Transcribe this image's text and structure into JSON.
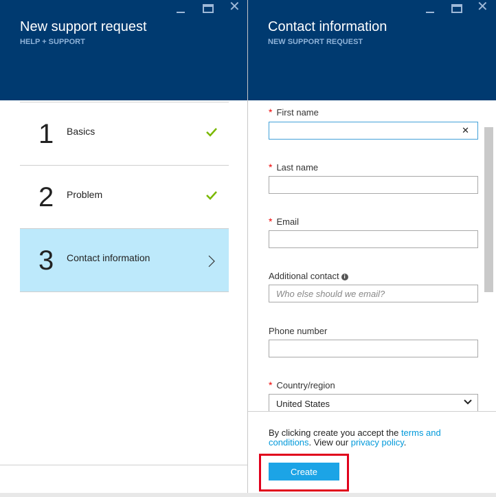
{
  "left_blade": {
    "title": "New support request",
    "subtitle": "HELP + SUPPORT",
    "steps": [
      {
        "number": "1",
        "label": "Basics",
        "status": "complete"
      },
      {
        "number": "2",
        "label": "Problem",
        "status": "complete"
      },
      {
        "number": "3",
        "label": "Contact information",
        "status": "active"
      }
    ]
  },
  "right_blade": {
    "title": "Contact information",
    "subtitle": "NEW SUPPORT REQUEST",
    "fields": {
      "first_name": {
        "label": "First name",
        "value": "",
        "required": true
      },
      "last_name": {
        "label": "Last name",
        "value": "",
        "required": true
      },
      "email": {
        "label": "Email",
        "value": "",
        "required": true
      },
      "additional_contact": {
        "label": "Additional contact",
        "placeholder": "Who else should we email?",
        "value": ""
      },
      "phone": {
        "label": "Phone number",
        "value": ""
      },
      "country": {
        "label": "Country/region",
        "value": "United States",
        "required": true
      }
    },
    "terms": {
      "prefix": "By clicking create you accept the ",
      "terms_link": "terms and conditions",
      "middle": ". View our ",
      "privacy_link": "privacy policy",
      "suffix": "."
    },
    "create_label": "Create"
  },
  "symbols": {
    "required": "*",
    "clear": "✕",
    "info": "i"
  },
  "colors": {
    "header": "#003a70",
    "active_step": "#bde9fb",
    "check": "#7ab800",
    "accent": "#1ca4e6",
    "highlight": "#e0001b"
  }
}
